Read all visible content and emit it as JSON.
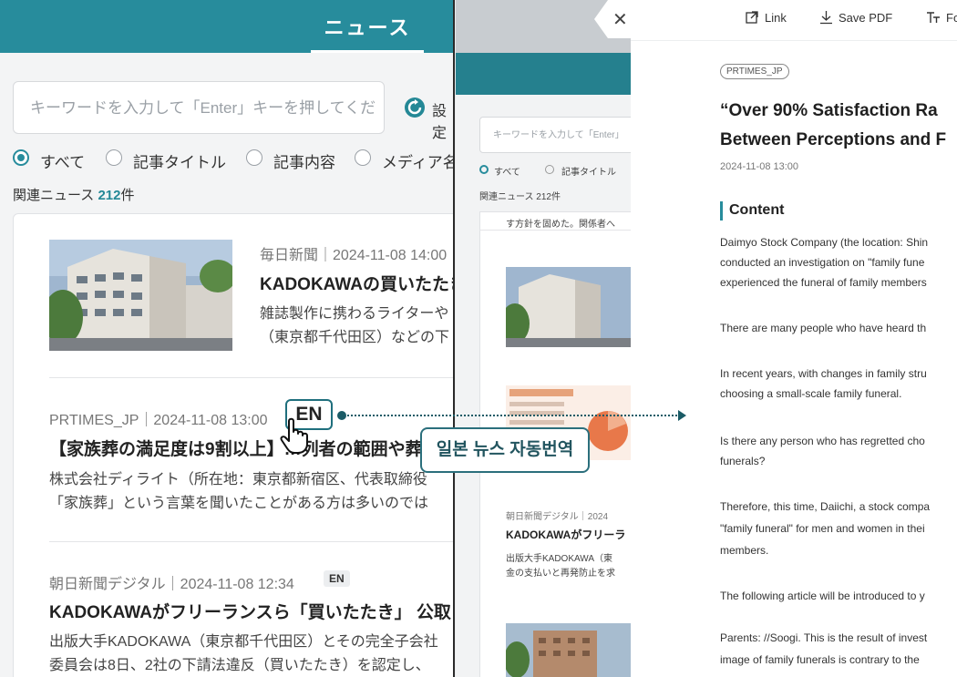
{
  "left": {
    "tab": "ニュース",
    "search_placeholder": "キーワードを入力して「Enter」キーを押してくだ",
    "settings_label": "設定",
    "filters": [
      "すべて",
      "記事タイトル",
      "記事内容",
      "メディア名"
    ],
    "related_prefix": "関連ニュース",
    "related_count": "212",
    "related_suffix": "件",
    "articles": [
      {
        "meta": "毎日新聞｜2024-11-08 14:00",
        "title": "KADOKAWAの買いたたき",
        "body1": "雑誌製作に携わるライターや",
        "body2": "（東京都千代田区）などの下"
      },
      {
        "meta": "PRTIMES_JP｜2024-11-08 13:00",
        "title": "【家族葬の満足度は9割以上】…列者の範囲や葬",
        "body1": "株式会社ディライト（所在地：東京都新宿区、代表取締役",
        "body2": "「家族葬」という言葉を聞いたことがある方は多いのでは"
      },
      {
        "meta": "朝日新聞デジタル｜2024-11-08 12:34",
        "en": "EN",
        "title": "KADOKAWAがフリーランスら「買いたたき」 公取",
        "body1": "出版大手KADOKAWA（東京都千代田区）とその完全子会社",
        "body2": "委員会は8日、2社の下請法違反（買いたたき）を認定し、"
      }
    ]
  },
  "middle": {
    "search_placeholder": "キーワードを入力して「Enter」",
    "filters": [
      "すべて",
      "記事タイトル"
    ],
    "related": "関連ニュース 212件",
    "snippet_top": "す方針を固めた。関係者へ",
    "meta": "朝日新聞デジタル｜2024",
    "title": "KADOKAWAがフリーラ",
    "body1": "出版大手KADOKAWA（東",
    "body2": "金の支払いと再発防止を求"
  },
  "right": {
    "toolbar": {
      "link": "Link",
      "save_pdf": "Save PDF",
      "font": "Fo"
    },
    "source": "PRTIMES_JP",
    "title_line1": "“Over 90% Satisfaction Ra",
    "title_line2": "Between Perceptions and F",
    "date": "2024-11-08 13:00",
    "content_heading": "Content",
    "paragraphs": [
      "Daimyo Stock Company (the location: Shin",
      "conducted an investigation on \"family fune",
      "experienced the funeral of family members",
      "There are many people who have heard th",
      "In recent years, with changes in family stru",
      "choosing a small-scale family funeral.",
      "Is there any person who has regretted cho",
      "funerals?",
      "Therefore, this time, Daiichi, a stock compa",
      "\"family funeral\" for men and women in thei",
      "members.",
      "The following article will be introduced to y",
      "Parents: //Soogi. This is the result of invest",
      "image of family funerals is contrary to the"
    ]
  },
  "annotation": {
    "en_callout": "EN",
    "korean_label": "일본 뉴스 자동번역"
  },
  "colors": {
    "teal": "#278c9c",
    "dark_teal": "#1a5b66"
  }
}
